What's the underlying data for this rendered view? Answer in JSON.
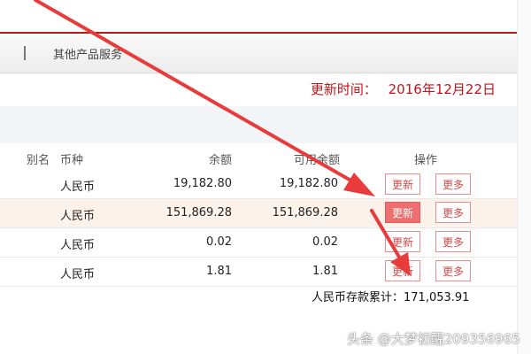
{
  "nav": {
    "other_link": "其他产品服务"
  },
  "update": {
    "label": "更新时间：",
    "date": "2016年12月22日"
  },
  "table": {
    "headers": {
      "alias": "别名",
      "currency": "币种",
      "balance": "余额",
      "available": "可用余额",
      "ops": "操作"
    },
    "rows": [
      {
        "currency": "人民币",
        "balance": "19,182.80",
        "available": "19,182.80",
        "update_label": "更新",
        "more_label": "更多"
      },
      {
        "currency": "人民币",
        "balance": "151,869.28",
        "available": "151,869.28",
        "update_label": "更新",
        "more_label": "更多"
      },
      {
        "currency": "人民币",
        "balance": "0.02",
        "available": "0.02",
        "update_label": "更新",
        "more_label": "更多"
      },
      {
        "currency": "人民币",
        "balance": "1.81",
        "available": "1.81",
        "update_label": "更新",
        "more_label": "更多"
      }
    ]
  },
  "summary": {
    "text": "人民币存款累计：171,053.91"
  },
  "watermark": "头条 @大梦初醒209356965",
  "colors": {
    "accent": "#c0151b",
    "arrow": "#e83b3b",
    "button_border": "#e88e8e",
    "button_active": "#ee6f6f"
  }
}
